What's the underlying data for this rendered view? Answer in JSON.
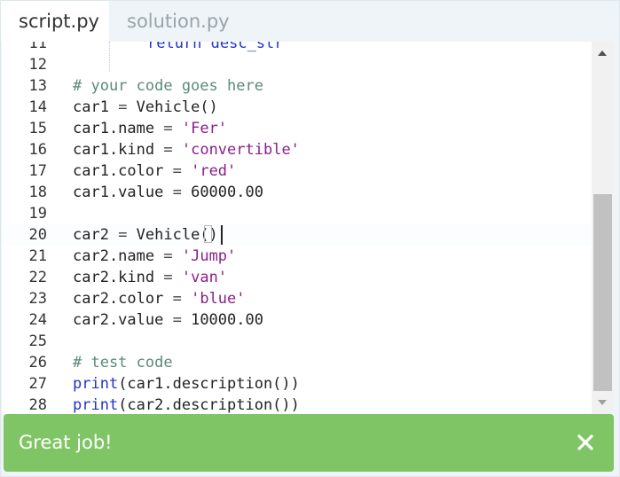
{
  "tabs": [
    {
      "label": "script.py",
      "active": true
    },
    {
      "label": "solution.py",
      "active": false
    }
  ],
  "editor": {
    "lines": [
      {
        "num": "11",
        "tokens": [
          {
            "t": "return desc_str",
            "c": "keyword-partial"
          }
        ]
      },
      {
        "num": "12",
        "tokens": []
      },
      {
        "num": "13",
        "tokens": [
          {
            "t": "# your code goes here",
            "c": "comment"
          }
        ]
      },
      {
        "num": "14",
        "tokens": [
          {
            "t": "car1 ",
            "c": ""
          },
          {
            "t": "=",
            "c": "op"
          },
          {
            "t": " Vehicle()",
            "c": ""
          }
        ]
      },
      {
        "num": "15",
        "tokens": [
          {
            "t": "car1.name ",
            "c": ""
          },
          {
            "t": "=",
            "c": "op"
          },
          {
            "t": " ",
            "c": ""
          },
          {
            "t": "'Fer'",
            "c": "string"
          }
        ]
      },
      {
        "num": "16",
        "tokens": [
          {
            "t": "car1.kind ",
            "c": ""
          },
          {
            "t": "=",
            "c": "op"
          },
          {
            "t": " ",
            "c": ""
          },
          {
            "t": "'convertible'",
            "c": "string"
          }
        ]
      },
      {
        "num": "17",
        "tokens": [
          {
            "t": "car1.color ",
            "c": ""
          },
          {
            "t": "=",
            "c": "op"
          },
          {
            "t": " ",
            "c": ""
          },
          {
            "t": "'red'",
            "c": "string"
          }
        ]
      },
      {
        "num": "18",
        "tokens": [
          {
            "t": "car1.value ",
            "c": ""
          },
          {
            "t": "=",
            "c": "op"
          },
          {
            "t": " 60000.00",
            "c": ""
          }
        ]
      },
      {
        "num": "19",
        "tokens": []
      },
      {
        "num": "20",
        "tokens": [
          {
            "t": "car2 ",
            "c": ""
          },
          {
            "t": "=",
            "c": "op"
          },
          {
            "t": " Vehicle()",
            "c": ""
          }
        ],
        "active": true
      },
      {
        "num": "21",
        "tokens": [
          {
            "t": "car2.name ",
            "c": ""
          },
          {
            "t": "=",
            "c": "op"
          },
          {
            "t": " ",
            "c": ""
          },
          {
            "t": "'Jump'",
            "c": "string"
          }
        ]
      },
      {
        "num": "22",
        "tokens": [
          {
            "t": "car2.kind ",
            "c": ""
          },
          {
            "t": "=",
            "c": "op"
          },
          {
            "t": " ",
            "c": ""
          },
          {
            "t": "'van'",
            "c": "string"
          }
        ]
      },
      {
        "num": "23",
        "tokens": [
          {
            "t": "car2.color ",
            "c": ""
          },
          {
            "t": "=",
            "c": "op"
          },
          {
            "t": " ",
            "c": ""
          },
          {
            "t": "'blue'",
            "c": "string"
          }
        ]
      },
      {
        "num": "24",
        "tokens": [
          {
            "t": "car2.value ",
            "c": ""
          },
          {
            "t": "=",
            "c": "op"
          },
          {
            "t": " 10000.00",
            "c": ""
          }
        ]
      },
      {
        "num": "25",
        "tokens": []
      },
      {
        "num": "26",
        "tokens": [
          {
            "t": "# test code",
            "c": "comment"
          }
        ]
      },
      {
        "num": "27",
        "tokens": [
          {
            "t": "print",
            "c": "builtin"
          },
          {
            "t": "(car1.description())",
            "c": ""
          }
        ]
      },
      {
        "num": "28",
        "tokens": [
          {
            "t": "print",
            "c": "builtin"
          },
          {
            "t": "(car2.description())",
            "c": ""
          }
        ]
      }
    ]
  },
  "toast": {
    "message": "Great job!",
    "close_icon": "close-icon",
    "color": "#80c565"
  },
  "colors": {
    "comment": "#5a8a7a",
    "string": "#8a1f8a",
    "keyword": "#2233cc"
  }
}
